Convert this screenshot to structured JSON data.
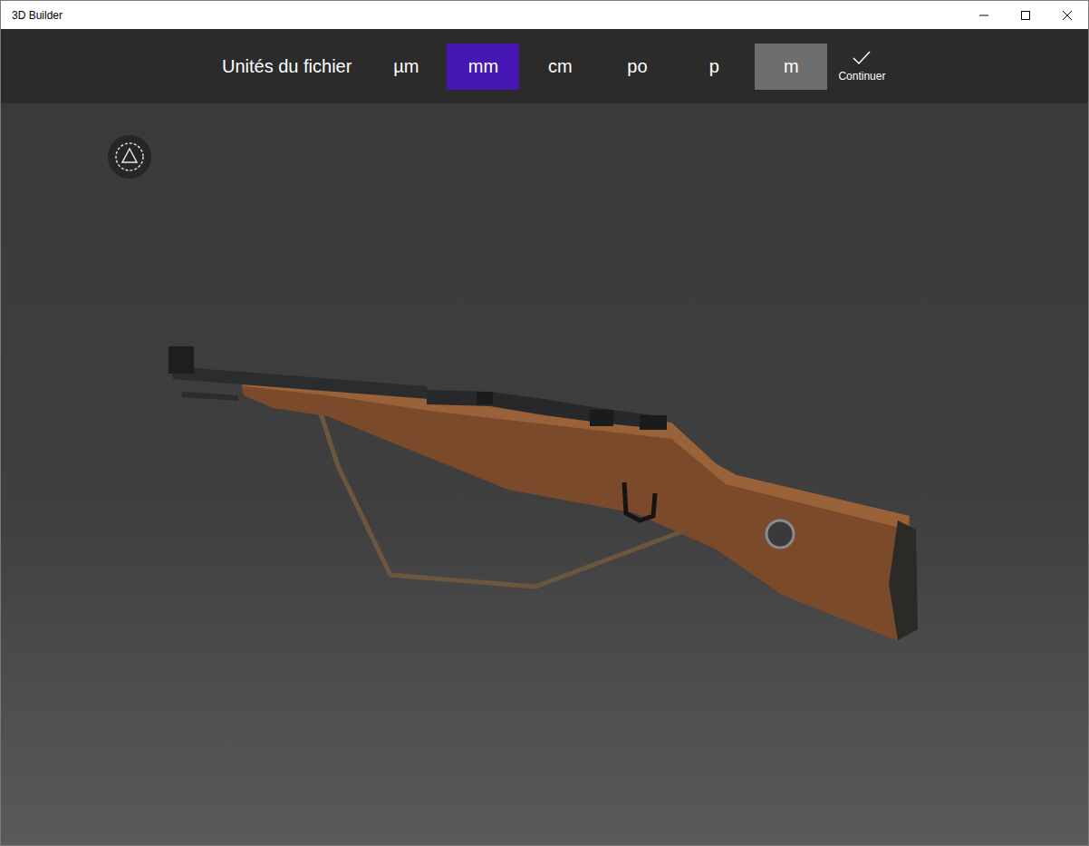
{
  "window": {
    "title": "3D Builder"
  },
  "toolbar": {
    "label": "Unités du fichier",
    "units": [
      {
        "label": "µm",
        "selected": false,
        "highlighted": false
      },
      {
        "label": "mm",
        "selected": true,
        "highlighted": false
      },
      {
        "label": "cm",
        "selected": false,
        "highlighted": false
      },
      {
        "label": "po",
        "selected": false,
        "highlighted": false
      },
      {
        "label": "p",
        "selected": false,
        "highlighted": false
      },
      {
        "label": "m",
        "selected": false,
        "highlighted": true
      }
    ],
    "continue": {
      "label": "Continuer"
    }
  }
}
